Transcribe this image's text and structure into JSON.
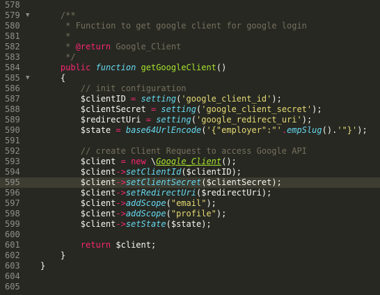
{
  "editor": {
    "lines": [
      {
        "num": "578",
        "fold": "",
        "tokens": []
      },
      {
        "num": "579",
        "fold": "▼",
        "tokens": [
          {
            "t": "    ",
            "c": "p"
          },
          {
            "t": "/**",
            "c": "c"
          }
        ]
      },
      {
        "num": "580",
        "fold": "",
        "tokens": [
          {
            "t": "     ",
            "c": "p"
          },
          {
            "t": "* Function to get google client for google login",
            "c": "c"
          }
        ]
      },
      {
        "num": "581",
        "fold": "",
        "tokens": [
          {
            "t": "     ",
            "c": "p"
          },
          {
            "t": "*",
            "c": "c"
          }
        ]
      },
      {
        "num": "582",
        "fold": "",
        "tokens": [
          {
            "t": "     ",
            "c": "p"
          },
          {
            "t": "* ",
            "c": "c"
          },
          {
            "t": "@return",
            "c": "ctag"
          },
          {
            "t": " ",
            "c": "c"
          },
          {
            "t": "Google_Client",
            "c": "c"
          }
        ]
      },
      {
        "num": "583",
        "fold": "",
        "tokens": [
          {
            "t": "     ",
            "c": "p"
          },
          {
            "t": "*/",
            "c": "c"
          }
        ]
      },
      {
        "num": "584",
        "fold": "",
        "tokens": [
          {
            "t": "    ",
            "c": "p"
          },
          {
            "t": "public",
            "c": "k"
          },
          {
            "t": " ",
            "c": "p"
          },
          {
            "t": "function",
            "c": "st"
          },
          {
            "t": " ",
            "c": "p"
          },
          {
            "t": "getGoogleClient",
            "c": "f"
          },
          {
            "t": "()",
            "c": "p"
          }
        ]
      },
      {
        "num": "585",
        "fold": "▼",
        "tokens": [
          {
            "t": "    ",
            "c": "p"
          },
          {
            "t": "{",
            "c": "p"
          }
        ]
      },
      {
        "num": "586",
        "fold": "",
        "tokens": [
          {
            "t": "        ",
            "c": "p"
          },
          {
            "t": "// init configuration",
            "c": "c"
          }
        ]
      },
      {
        "num": "587",
        "fold": "",
        "tokens": [
          {
            "t": "        ",
            "c": "p"
          },
          {
            "t": "$clientID",
            "c": "v"
          },
          {
            "t": " = ",
            "c": "o"
          },
          {
            "t": "setting",
            "c": "st"
          },
          {
            "t": "(",
            "c": "p"
          },
          {
            "t": "'google_client_id'",
            "c": "s"
          },
          {
            "t": ");",
            "c": "p"
          }
        ]
      },
      {
        "num": "588",
        "fold": "",
        "tokens": [
          {
            "t": "        ",
            "c": "p"
          },
          {
            "t": "$clientSecret",
            "c": "v"
          },
          {
            "t": " = ",
            "c": "o"
          },
          {
            "t": "setting",
            "c": "st"
          },
          {
            "t": "(",
            "c": "p"
          },
          {
            "t": "'google_client_secret'",
            "c": "s"
          },
          {
            "t": ");",
            "c": "p"
          }
        ]
      },
      {
        "num": "589",
        "fold": "",
        "tokens": [
          {
            "t": "        ",
            "c": "p"
          },
          {
            "t": "$redirectUri",
            "c": "v"
          },
          {
            "t": " = ",
            "c": "o"
          },
          {
            "t": "setting",
            "c": "st"
          },
          {
            "t": "(",
            "c": "p"
          },
          {
            "t": "'google_redirect_uri'",
            "c": "s"
          },
          {
            "t": ");",
            "c": "p"
          }
        ]
      },
      {
        "num": "590",
        "fold": "",
        "tokens": [
          {
            "t": "        ",
            "c": "p"
          },
          {
            "t": "$state",
            "c": "v"
          },
          {
            "t": " = ",
            "c": "o"
          },
          {
            "t": "base64UrlEncode",
            "c": "st"
          },
          {
            "t": "(",
            "c": "p"
          },
          {
            "t": "'{\"employer\":\"'",
            "c": "s"
          },
          {
            "t": ".",
            "c": "o"
          },
          {
            "t": "empSlug",
            "c": "st"
          },
          {
            "t": "().",
            "c": "p"
          },
          {
            "t": "'\"}'",
            "c": "s"
          },
          {
            "t": ");",
            "c": "p"
          }
        ]
      },
      {
        "num": "591",
        "fold": "",
        "tokens": []
      },
      {
        "num": "592",
        "fold": "",
        "tokens": [
          {
            "t": "        ",
            "c": "p"
          },
          {
            "t": "// create Client Request to access Google API",
            "c": "c"
          }
        ]
      },
      {
        "num": "593",
        "fold": "",
        "tokens": [
          {
            "t": "        ",
            "c": "p"
          },
          {
            "t": "$client",
            "c": "v"
          },
          {
            "t": " = ",
            "c": "o"
          },
          {
            "t": "new",
            "c": "k"
          },
          {
            "t": " \\",
            "c": "p"
          },
          {
            "t": "Google_Client",
            "c": "cls"
          },
          {
            "t": "();",
            "c": "p"
          }
        ]
      },
      {
        "num": "594",
        "fold": "",
        "tokens": [
          {
            "t": "        ",
            "c": "p"
          },
          {
            "t": "$client",
            "c": "v"
          },
          {
            "t": "->",
            "c": "o"
          },
          {
            "t": "setClientId",
            "c": "st"
          },
          {
            "t": "(",
            "c": "p"
          },
          {
            "t": "$clientID",
            "c": "v"
          },
          {
            "t": ");",
            "c": "p"
          }
        ]
      },
      {
        "num": "595",
        "fold": "",
        "hl": true,
        "tokens": [
          {
            "t": "        ",
            "c": "p"
          },
          {
            "t": "$client",
            "c": "v"
          },
          {
            "t": "->",
            "c": "o"
          },
          {
            "t": "setClientSecret",
            "c": "st"
          },
          {
            "t": "(",
            "c": "p"
          },
          {
            "t": "$clientSecret",
            "c": "v"
          },
          {
            "t": ");",
            "c": "p"
          }
        ]
      },
      {
        "num": "596",
        "fold": "",
        "tokens": [
          {
            "t": "        ",
            "c": "p"
          },
          {
            "t": "$client",
            "c": "v"
          },
          {
            "t": "->",
            "c": "o"
          },
          {
            "t": "setRedirectUri",
            "c": "st"
          },
          {
            "t": "(",
            "c": "p"
          },
          {
            "t": "$redirectUri",
            "c": "v"
          },
          {
            "t": ");",
            "c": "p"
          }
        ]
      },
      {
        "num": "597",
        "fold": "",
        "tokens": [
          {
            "t": "        ",
            "c": "p"
          },
          {
            "t": "$client",
            "c": "v"
          },
          {
            "t": "->",
            "c": "o"
          },
          {
            "t": "addScope",
            "c": "st"
          },
          {
            "t": "(",
            "c": "p"
          },
          {
            "t": "\"email\"",
            "c": "s"
          },
          {
            "t": ");",
            "c": "p"
          }
        ]
      },
      {
        "num": "598",
        "fold": "",
        "tokens": [
          {
            "t": "        ",
            "c": "p"
          },
          {
            "t": "$client",
            "c": "v"
          },
          {
            "t": "->",
            "c": "o"
          },
          {
            "t": "addScope",
            "c": "st"
          },
          {
            "t": "(",
            "c": "p"
          },
          {
            "t": "\"profile\"",
            "c": "s"
          },
          {
            "t": ");",
            "c": "p"
          }
        ]
      },
      {
        "num": "599",
        "fold": "",
        "tokens": [
          {
            "t": "        ",
            "c": "p"
          },
          {
            "t": "$client",
            "c": "v"
          },
          {
            "t": "->",
            "c": "o"
          },
          {
            "t": "setState",
            "c": "st"
          },
          {
            "t": "(",
            "c": "p"
          },
          {
            "t": "$state",
            "c": "v"
          },
          {
            "t": ");",
            "c": "p"
          }
        ]
      },
      {
        "num": "600",
        "fold": "",
        "tokens": []
      },
      {
        "num": "601",
        "fold": "",
        "tokens": [
          {
            "t": "        ",
            "c": "p"
          },
          {
            "t": "return",
            "c": "k"
          },
          {
            "t": " ",
            "c": "p"
          },
          {
            "t": "$client",
            "c": "v"
          },
          {
            "t": ";",
            "c": "p"
          }
        ]
      },
      {
        "num": "602",
        "fold": "",
        "tokens": [
          {
            "t": "    ",
            "c": "p"
          },
          {
            "t": "}",
            "c": "p"
          }
        ]
      },
      {
        "num": "603",
        "fold": "",
        "tokens": [
          {
            "t": "}",
            "c": "p"
          }
        ]
      },
      {
        "num": "604",
        "fold": "",
        "tokens": []
      },
      {
        "num": "605",
        "fold": "",
        "tokens": []
      }
    ]
  },
  "theme": {
    "background": "#272822",
    "gutter_text": "#8f908a",
    "highlight_line": "#3e3d32",
    "comment": "#75715e",
    "keyword": "#f92672",
    "storage": "#66d9ef",
    "function": "#a6e22e",
    "string": "#e6db74",
    "foreground": "#f8f8f2"
  }
}
